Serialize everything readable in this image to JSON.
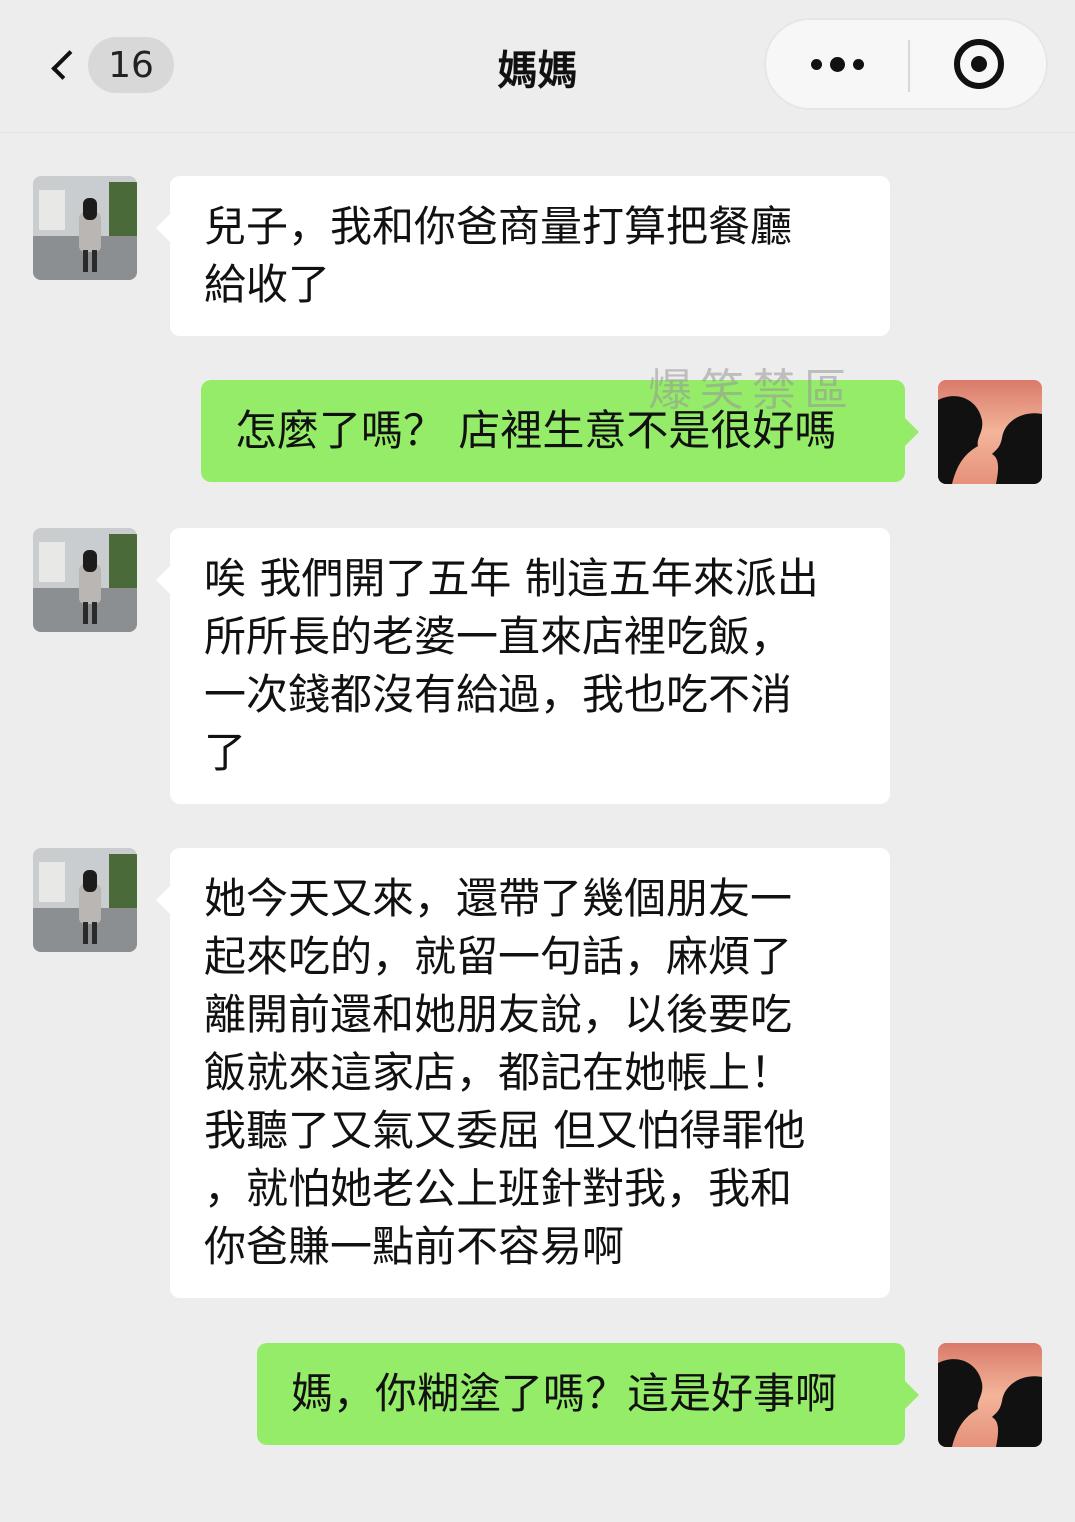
{
  "header": {
    "unread_count": "16",
    "title": "媽媽",
    "more_icon": "more-dots-icon",
    "close_icon": "target-circle-icon"
  },
  "watermark": "爆笑禁區",
  "messages": [
    {
      "sender": "mom",
      "text": "兒子，我和你爸商量打算把餐廳\n給收了"
    },
    {
      "sender": "me",
      "text": "怎麼了嗎？ 店裡生意不是很好嗎"
    },
    {
      "sender": "mom",
      "text": "唉 我們開了五年 制這五年來派出\n所所長的老婆一直來店裡吃飯，\n一次錢都沒有給過，我也吃不消\n了"
    },
    {
      "sender": "mom",
      "text": "她今天又來，還帶了幾個朋友一\n起來吃的，就留一句話，麻煩了\n離開前還和她朋友說，以後要吃\n飯就來這家店，都記在她帳上！\n我聽了又氣又委屈 但又怕得罪他\n，就怕她老公上班針對我，我和\n你爸賺一點前不容易啊"
    },
    {
      "sender": "me",
      "text": "媽，你糊塗了嗎？這是好事啊"
    }
  ],
  "colors": {
    "background": "#ededed",
    "incoming_bubble": "#ffffff",
    "outgoing_bubble": "#95ec69"
  }
}
